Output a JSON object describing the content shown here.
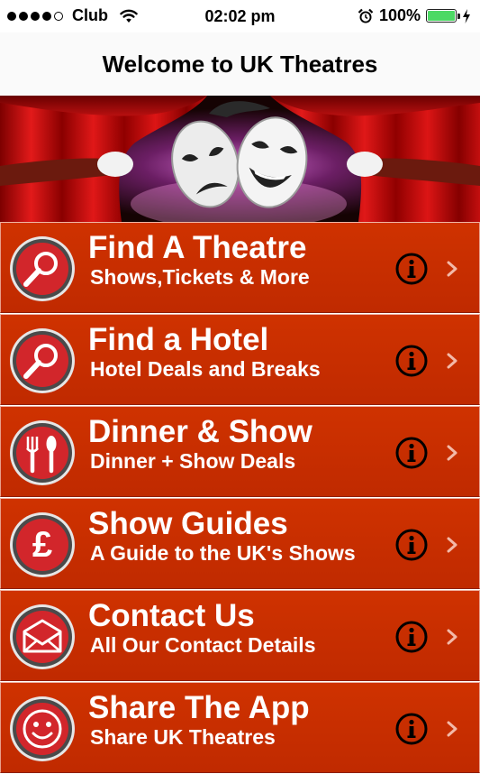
{
  "status_bar": {
    "carrier": "Club",
    "time": "02:02 pm",
    "battery_percent": "100%",
    "battery_level": 1.0,
    "signal_bars": 5,
    "signal_bars_filled": 4
  },
  "nav": {
    "title": "Welcome to UK Theatres"
  },
  "banner": {
    "description_icon": "theatre-masks-curtains"
  },
  "colors": {
    "menu_background": "#c92e00",
    "text": "#ffffff",
    "info_icon": "#000000",
    "chevron": "#f3b9a8",
    "battery": "#4cd964"
  },
  "menu": {
    "items": [
      {
        "title": "Find A Theatre",
        "subtitle": "Shows,Tickets & More",
        "icon": "search-icon"
      },
      {
        "title": "Find a Hotel",
        "subtitle": "Hotel Deals and  Breaks",
        "icon": "search-icon"
      },
      {
        "title": "Dinner & Show",
        "subtitle": "Dinner + Show Deals",
        "icon": "cutlery-icon"
      },
      {
        "title": "Show Guides",
        "subtitle": "A Guide to the UK's Shows",
        "icon": "pound-icon"
      },
      {
        "title": "Contact Us",
        "subtitle": "All Our Contact Details",
        "icon": "envelope-icon"
      },
      {
        "title": "Share The App",
        "subtitle": "Share UK Theatres",
        "icon": "smiley-icon"
      }
    ]
  }
}
